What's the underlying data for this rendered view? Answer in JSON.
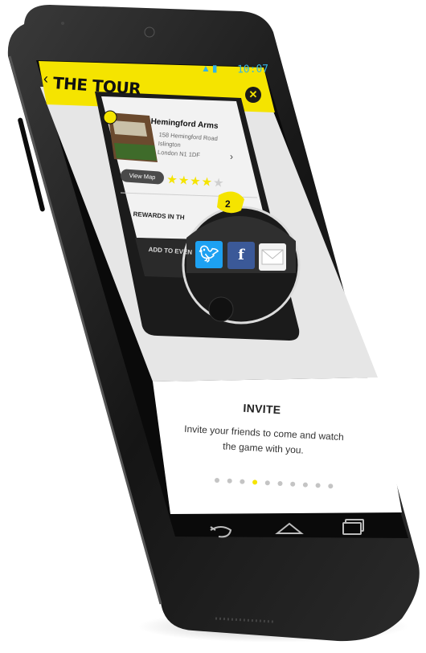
{
  "status_bar": {
    "time": "10:07",
    "signal_icon": "signal-icon",
    "battery_icon": "battery-icon"
  },
  "app_bar": {
    "title": "THE TOUR",
    "back_icon": "chevron-left-icon",
    "close_icon": "close-icon",
    "accent": "#f5e400"
  },
  "venue": {
    "name": "Hemingford Arms",
    "address": "158 Hemingford Road\nIslington\nLondon N1 1DF",
    "view_map_label": "View Map",
    "rating": 4,
    "max_rating": 5
  },
  "rewards_label": "REWARDS IN TH",
  "add_event_label": "ADD TO EVEN",
  "badge_count": "2",
  "share": {
    "twitter_icon": "twitter-icon",
    "facebook_icon": "facebook-icon",
    "email_icon": "email-icon"
  },
  "onboarding": {
    "title": "INVITE",
    "body": "Invite your friends to come and watch the game with you.",
    "page_count": 10,
    "active_page": 3
  },
  "nav_bar": {
    "back_icon": "back-icon",
    "home_icon": "home-icon",
    "recents_icon": "recents-icon"
  }
}
